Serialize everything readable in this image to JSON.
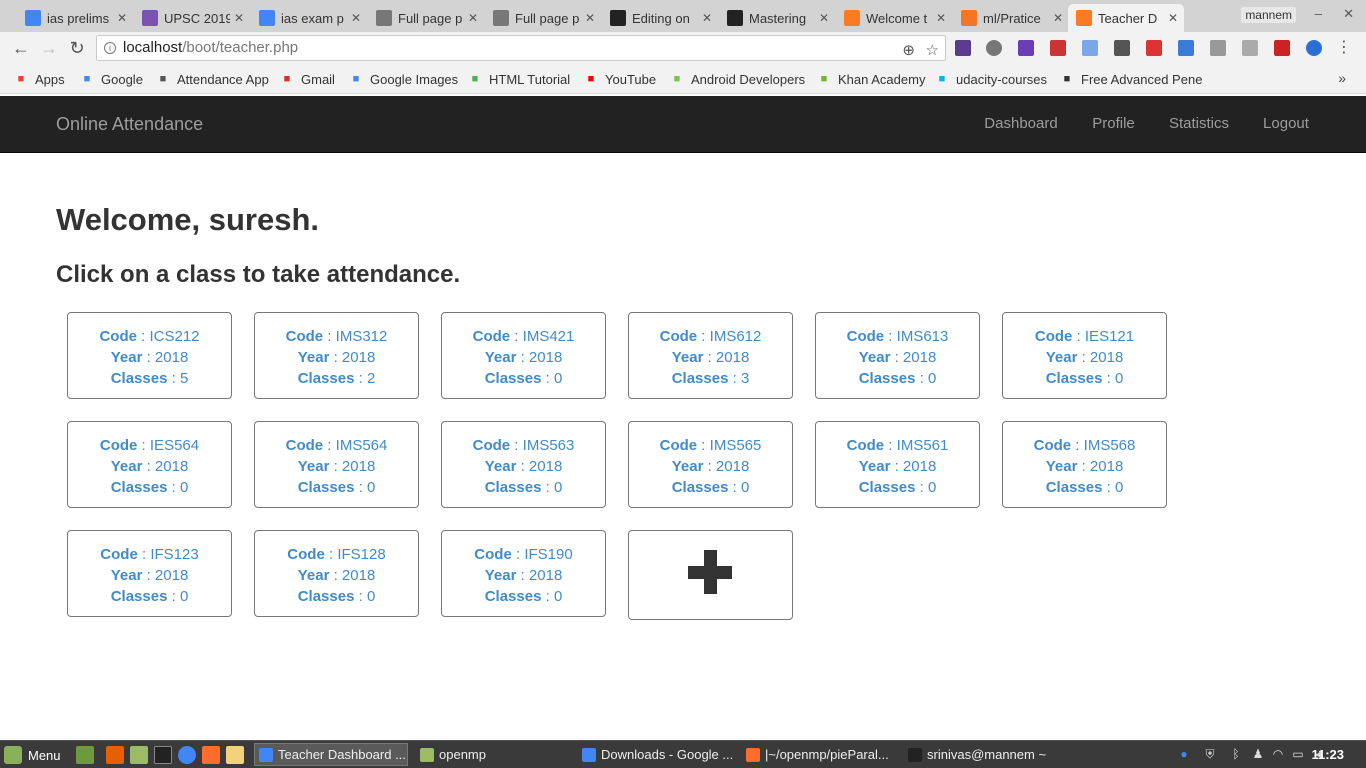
{
  "browser": {
    "tabs": [
      {
        "title": "ias prelims",
        "icon": "google-icon",
        "color": "#4285f4"
      },
      {
        "title": "UPSC 2019",
        "icon": "bootstrap-icon",
        "color": "#7952b3"
      },
      {
        "title": "ias exam p",
        "icon": "google-icon",
        "color": "#4285f4"
      },
      {
        "title": "Full page p",
        "icon": "page-icon",
        "color": "#777777"
      },
      {
        "title": "Full page p",
        "icon": "page-icon",
        "color": "#777777"
      },
      {
        "title": "Editing on",
        "icon": "github-icon",
        "color": "#222222"
      },
      {
        "title": "Mastering",
        "icon": "github-icon",
        "color": "#222222"
      },
      {
        "title": "Welcome t",
        "icon": "xampp-icon",
        "color": "#fb7a24"
      },
      {
        "title": "ml/Pratice",
        "icon": "jupyter-icon",
        "color": "#f37626"
      },
      {
        "title": "Teacher D",
        "icon": "xampp-icon",
        "color": "#fb7a24"
      }
    ],
    "user_label": "mannem",
    "url_host": "localhost",
    "url_path": "/boot/teacher.php",
    "bookmarks": [
      {
        "label": "Apps",
        "icon": "apps-grid-icon",
        "color": "#e94235"
      },
      {
        "label": "Google",
        "icon": "google-icon",
        "color": "#4285f4"
      },
      {
        "label": "Attendance App",
        "icon": "page-icon",
        "color": "#555555"
      },
      {
        "label": "Gmail",
        "icon": "gmail-icon",
        "color": "#d93025"
      },
      {
        "label": "Google Images",
        "icon": "google-icon",
        "color": "#4285f4"
      },
      {
        "label": "HTML Tutorial",
        "icon": "w3schools-icon",
        "color": "#4caf50"
      },
      {
        "label": "YouTube",
        "icon": "youtube-icon",
        "color": "#ff0000"
      },
      {
        "label": "Android Developers",
        "icon": "android-icon",
        "color": "#78c257"
      },
      {
        "label": "Khan Academy",
        "icon": "khan-academy-icon",
        "color": "#6fb534"
      },
      {
        "label": "udacity-courses",
        "icon": "udacity-icon",
        "color": "#02b3e4"
      },
      {
        "label": "Free Advanced Pene",
        "icon": "page-icon",
        "color": "#333333"
      }
    ],
    "more_bookmarks": "»"
  },
  "app": {
    "brand": "Online Attendance",
    "nav": [
      {
        "label": "Dashboard",
        "active": true
      },
      {
        "label": "Profile",
        "active": false
      },
      {
        "label": "Statistics",
        "active": false
      },
      {
        "label": "Logout",
        "active": false
      }
    ],
    "welcome": "Welcome, suresh.",
    "instruction": "Click on a class to take attendance.",
    "field_labels": {
      "code": "Code",
      "year": "Year",
      "classes": "Classes",
      "sep": " : "
    },
    "classes": [
      {
        "code": "ICS212",
        "year": "2018",
        "classes": "5"
      },
      {
        "code": "IMS312",
        "year": "2018",
        "classes": "2"
      },
      {
        "code": "IMS421",
        "year": "2018",
        "classes": "0"
      },
      {
        "code": "IMS612",
        "year": "2018",
        "classes": "3"
      },
      {
        "code": "IMS613",
        "year": "2018",
        "classes": "0"
      },
      {
        "code": "IES121",
        "year": "2018",
        "classes": "0"
      },
      {
        "code": "IES564",
        "year": "2018",
        "classes": "0"
      },
      {
        "code": "IMS564",
        "year": "2018",
        "classes": "0"
      },
      {
        "code": "IMS563",
        "year": "2018",
        "classes": "0"
      },
      {
        "code": "IMS565",
        "year": "2018",
        "classes": "0"
      },
      {
        "code": "IMS561",
        "year": "2018",
        "classes": "0"
      },
      {
        "code": "IMS568",
        "year": "2018",
        "classes": "0"
      },
      {
        "code": "IFS123",
        "year": "2018",
        "classes": "0"
      },
      {
        "code": "IFS128",
        "year": "2018",
        "classes": "0"
      },
      {
        "code": "IFS190",
        "year": "2018",
        "classes": "0"
      }
    ],
    "accent_color": "#428bca"
  },
  "taskbar": {
    "menu_label": "Menu",
    "windows": [
      {
        "label": "Teacher Dashboard ...",
        "icon": "chrome-icon",
        "active": true
      },
      {
        "label": "openmp",
        "icon": "folder-icon",
        "active": false
      },
      {
        "label": "Downloads - Google ...",
        "icon": "chrome-icon",
        "active": false
      },
      {
        "label": "|~/openmp/pieParal...",
        "icon": "sublime-icon",
        "active": false
      },
      {
        "label": "srinivas@mannem ~",
        "icon": "terminal-icon",
        "active": false
      }
    ],
    "clock": "11:23"
  }
}
